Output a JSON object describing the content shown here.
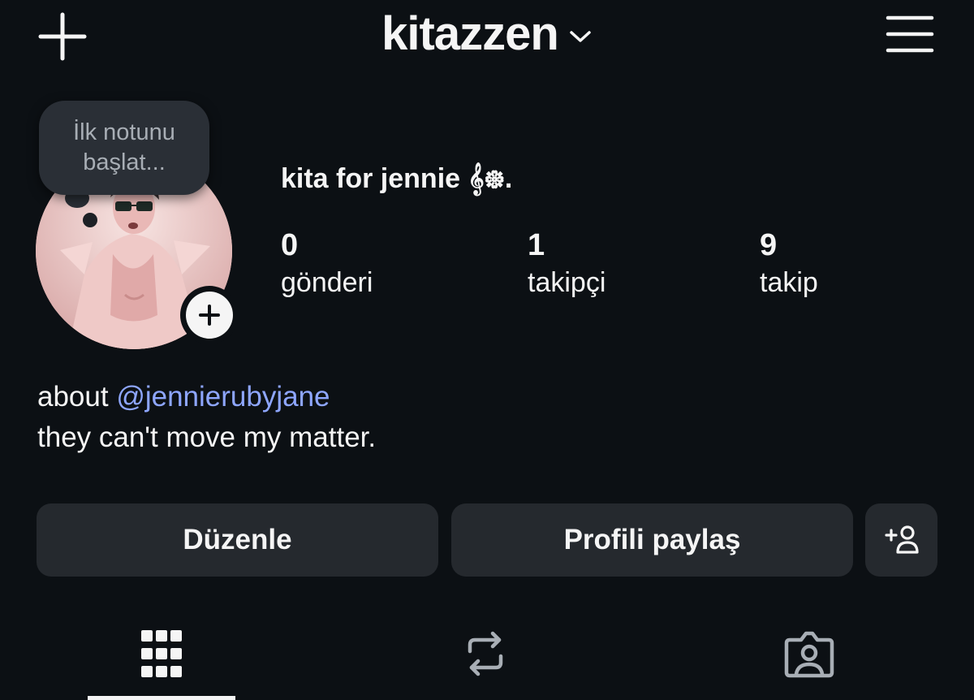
{
  "header": {
    "username": "kitazzen",
    "new_post_icon": "plus-icon",
    "account_switch_icon": "chevron-down-icon",
    "menu_icon": "hamburger-menu-icon"
  },
  "note": {
    "placeholder": "İlk notunu başlat..."
  },
  "profile": {
    "display_name": "kita for jennie 𝄞᪥.",
    "stats": [
      {
        "value": "0",
        "label": "gönderi"
      },
      {
        "value": "1",
        "label": "takipçi"
      },
      {
        "value": "9",
        "label": "takip"
      }
    ],
    "bio": {
      "prefix": "about ",
      "mention": "@jennierubyjane",
      "line2": "they can't move my matter."
    }
  },
  "actions": {
    "edit_label": "Düzenle",
    "share_label": "Profili paylaş",
    "discover_icon": "add-person-icon"
  },
  "tabs": [
    {
      "icon": "grid-icon",
      "active": true
    },
    {
      "icon": "repost-icon",
      "active": false
    },
    {
      "icon": "tagged-icon",
      "active": false
    }
  ],
  "colors": {
    "background": "#0c1014",
    "button": "#25292e",
    "mention": "#8ea6ff",
    "text": "#f5f5f5"
  }
}
